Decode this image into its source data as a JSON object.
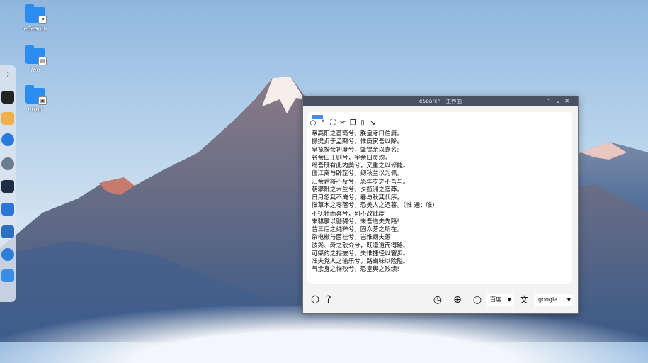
{
  "desktop": {
    "icons": [
      {
        "label": "eSearch"
      },
      {
        "label": "fan"
      },
      {
        "label": "nttoir"
      }
    ]
  },
  "window": {
    "title": "eSearch - 主界面",
    "controls": {
      "pin": "⌃",
      "minimize": "⌄",
      "close": "✕"
    }
  },
  "toolbar": {
    "icons": [
      "search-icon",
      "translate-icon",
      "screenshot-icon",
      "cut-icon",
      "copy-icon",
      "paste-icon",
      "wrap-icon"
    ]
  },
  "editor": {
    "lines": [
      "帝高阳之苗裔兮，朕皇考曰伯庸。",
      "摄提贞于孟陬兮，惟庚寅吾以降。",
      "皇览揆余初度兮，肇锡余以嘉名:",
      "名余曰正则兮，字余曰灵均。",
      "纷吾既有此内美兮，又重之以修能。",
      "僵江离与辟芷兮，纫秋兰以为佩。",
      "汩余若将不及兮，恐年岁之不吾与。",
      "朝攀阰之木兰兮，夕揽洲之宿莽。",
      "日月忽其不淹兮，春与秋其代序。",
      "惟草木之零落兮，恐美人之迟暮。（惟 通：唯）",
      "不抚壮而弃兮，何不改此度",
      "来骐骥以驰骋兮，来吾道夫先路!",
      "昔三后之纯粹兮，固众芳之所在。",
      "杂电椒与菌桂兮，岂惟纫夫蕙!",
      "彼尧、舜之耿介兮，既遵道而得路。",
      "可桀约之指披兮，夫惟捷径以窘步。",
      "准夫党人之偷乐兮，路幽味以险隘。",
      "气余身之惮殃兮，恐皇舆之败绩!"
    ]
  },
  "bottom_bar": {
    "search_engine": "百度",
    "translate_engine": "google",
    "help": "?"
  }
}
